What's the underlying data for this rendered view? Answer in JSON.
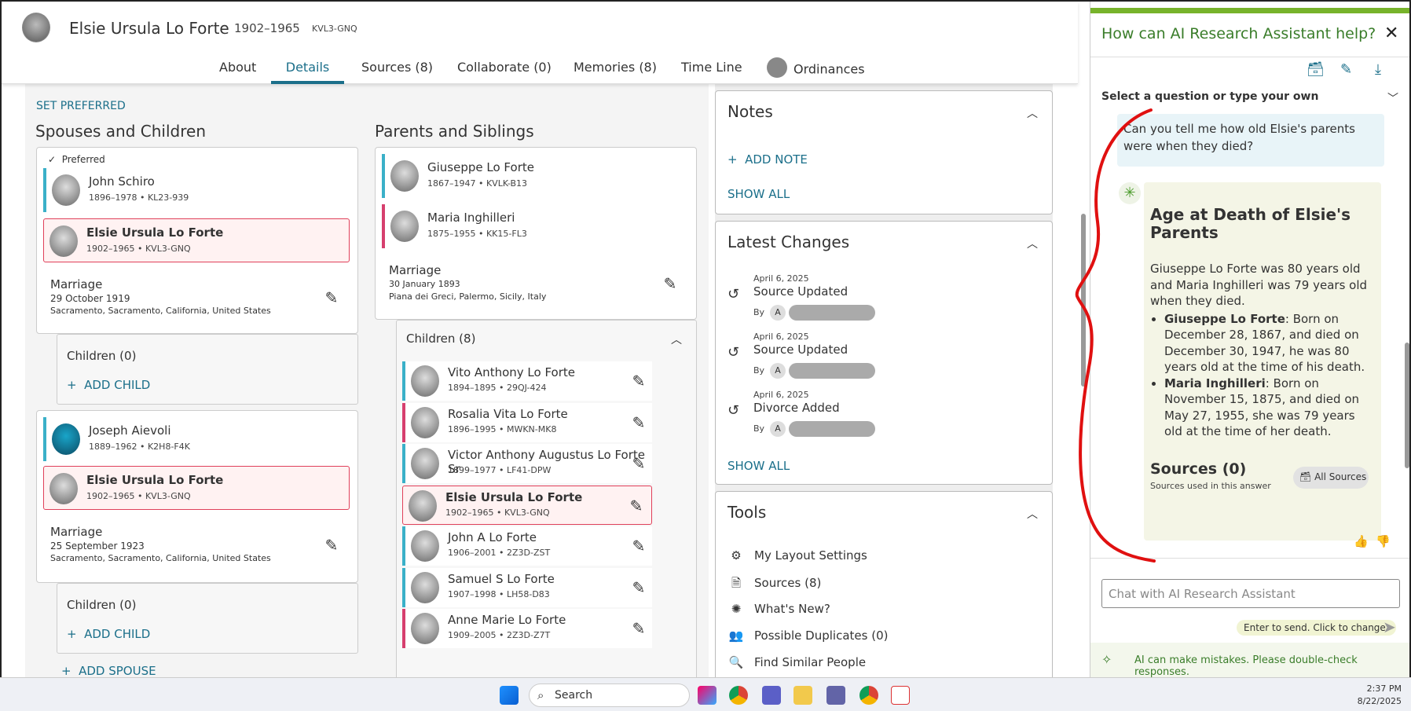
{
  "header": {
    "name": "Elsie Ursula Lo Forte",
    "dates": "1902–1965",
    "pid": "KVL3-GNQ"
  },
  "tabs": [
    "About",
    "Details",
    "Sources (8)",
    "Collaborate (0)",
    "Memories (8)",
    "Time Line",
    "Ordinances"
  ],
  "left": {
    "set_preferred": "SET PREFERRED",
    "spouses_title": "Spouses and Children",
    "preferred_label": "Preferred",
    "family1": {
      "spouse": {
        "name": "John Schiro",
        "life": "1896–1978 • KL23-939"
      },
      "self": {
        "name": "Elsie Ursula Lo Forte",
        "life": "1902–1965 • KVL3-GNQ"
      },
      "marriage_label": "Marriage",
      "marriage_date": "29 October 1919",
      "marriage_place": "Sacramento, Sacramento, California, United States",
      "children_label": "Children (0)",
      "add_child": "ADD CHILD"
    },
    "family2": {
      "spouse": {
        "name": "Joseph Aievoli",
        "life": "1889–1962 • K2H8-F4K"
      },
      "self": {
        "name": "Elsie Ursula Lo Forte",
        "life": "1902–1965 • KVL3-GNQ"
      },
      "marriage_label": "Marriage",
      "marriage_date": "25 September 1923",
      "marriage_place": "Sacramento, Sacramento, California, United States",
      "children_label": "Children (0)",
      "add_child": "ADD CHILD"
    },
    "add_spouse": "ADD SPOUSE"
  },
  "parents": {
    "title": "Parents and Siblings",
    "father": {
      "name": "Giuseppe Lo Forte",
      "life": "1867–1947 • KVLK-B13"
    },
    "mother": {
      "name": "Maria Inghilleri",
      "life": "1875–1955 • KK15-FL3"
    },
    "marriage_label": "Marriage",
    "marriage_date": "30 January 1893",
    "marriage_place": "Piana dei Greci, Palermo, Sicily, Italy",
    "children_label": "Children (8)",
    "children": [
      {
        "name": "Vito Anthony Lo Forte",
        "life": "1894–1895 • 29QJ-424",
        "sex": "m"
      },
      {
        "name": "Rosalia Vita Lo Forte",
        "life": "1896–1995 • MWKN-MK8",
        "sex": "f"
      },
      {
        "name": "Victor Anthony Augustus Lo Forte Sr",
        "life": "1899–1977 • LF41-DPW",
        "sex": "m"
      },
      {
        "name": "Elsie Ursula Lo Forte",
        "life": "1902–1965 • KVL3-GNQ",
        "sex": "f"
      },
      {
        "name": "John A Lo Forte",
        "life": "1906–2001 • 2Z3D-ZST",
        "sex": "m"
      },
      {
        "name": "Samuel S Lo Forte",
        "life": "1907–1998 • LH58-D83",
        "sex": "m"
      },
      {
        "name": "Anne Marie Lo Forte",
        "life": "1909–2005 • 2Z3D-Z7T",
        "sex": "f"
      }
    ]
  },
  "notes": {
    "title": "Notes",
    "add": "ADD NOTE",
    "show_all": "SHOW ALL"
  },
  "latest": {
    "title": "Latest Changes",
    "items": [
      {
        "date": "April 6, 2025",
        "type": "Source Updated",
        "by": "By",
        "initial": "A"
      },
      {
        "date": "April 6, 2025",
        "type": "Source Updated",
        "by": "By",
        "initial": "A"
      },
      {
        "date": "April 6, 2025",
        "type": "Divorce Added",
        "by": "By",
        "initial": "A"
      }
    ],
    "show_all": "SHOW ALL"
  },
  "tools": {
    "title": "Tools",
    "items": [
      "My Layout Settings",
      "Sources (8)",
      "What's New?",
      "Possible Duplicates (0)",
      "Find Similar People"
    ]
  },
  "ai": {
    "title": "How can AI Research Assistant help?",
    "select_label": "Select a question or type your own",
    "question": "Can you tell me how old Elsie's parents were when they died?",
    "answer_title": "Age at Death of Elsie's Parents",
    "answer_intro": "Giuseppe Lo Forte was 80 years old and Maria Inghilleri was 79 years old when they died.",
    "bullets": [
      {
        "bold": "Giuseppe Lo Forte",
        "text": ": Born on December 28, 1867, and died on December 30, 1947, he was 80 years old at the time of his death."
      },
      {
        "bold": "Maria Inghilleri",
        "text": ": Born on November 15, 1875, and died on May 27, 1955, she was 79 years old at the time of her death."
      }
    ],
    "sources_title": "Sources (0)",
    "sources_sub": "Sources used in this answer",
    "all_sources": "All Sources",
    "chat_placeholder": "Chat with AI Research Assistant",
    "enter_hint": "Enter to send. Click to change.",
    "disclaimer": "AI can make mistakes. Please double-check responses."
  },
  "taskbar": {
    "search": "Search",
    "time": "2:37 PM",
    "date": "8/22/2025"
  },
  "colors": {
    "accent": "#1b6f8a",
    "ai_green": "#77b32b",
    "male_bar": "#3ab0c8",
    "female_bar": "#d63f6e",
    "annotation": "#e01010"
  }
}
